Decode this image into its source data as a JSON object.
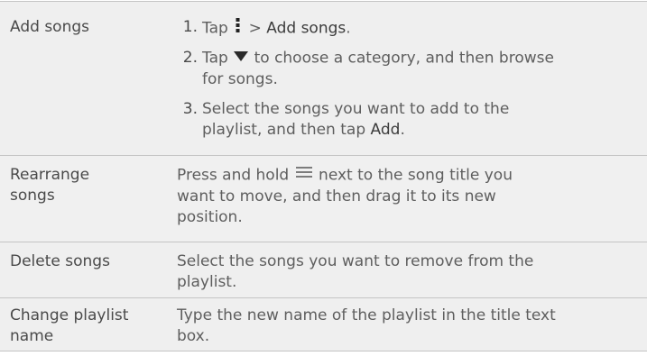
{
  "rows": [
    {
      "label": "Add songs",
      "steps": [
        {
          "num": "1.",
          "parts": [
            "Tap",
            "> ",
            "Add songs",
            "."
          ],
          "icon": "menu-dots-icon"
        },
        {
          "num": "2.",
          "line1_a": "Tap",
          "line1_b": "to choose a category, and then browse",
          "line2": "for songs.",
          "icon": "triangle-down-icon"
        },
        {
          "num": "3.",
          "line1": "Select the songs you want to add to the",
          "line2_a": "playlist, and then tap",
          "line2_b": "Add",
          "line2_c": "."
        }
      ]
    },
    {
      "label_l1": "Rearrange",
      "label_l2": "songs",
      "desc_l1_a": "Press and hold",
      "desc_l1_b": "next to the song title you",
      "desc_l2": "want to move, and then drag it to its new",
      "desc_l3": "position.",
      "icon": "drag-handle-icon"
    },
    {
      "label": "Delete songs",
      "desc_l1": "Select the songs you want to remove from the",
      "desc_l2": "playlist."
    },
    {
      "label_l1": "Change playlist",
      "label_l2": "name",
      "desc_l1": "Type the new name of the playlist in the title text",
      "desc_l2": "box."
    }
  ]
}
